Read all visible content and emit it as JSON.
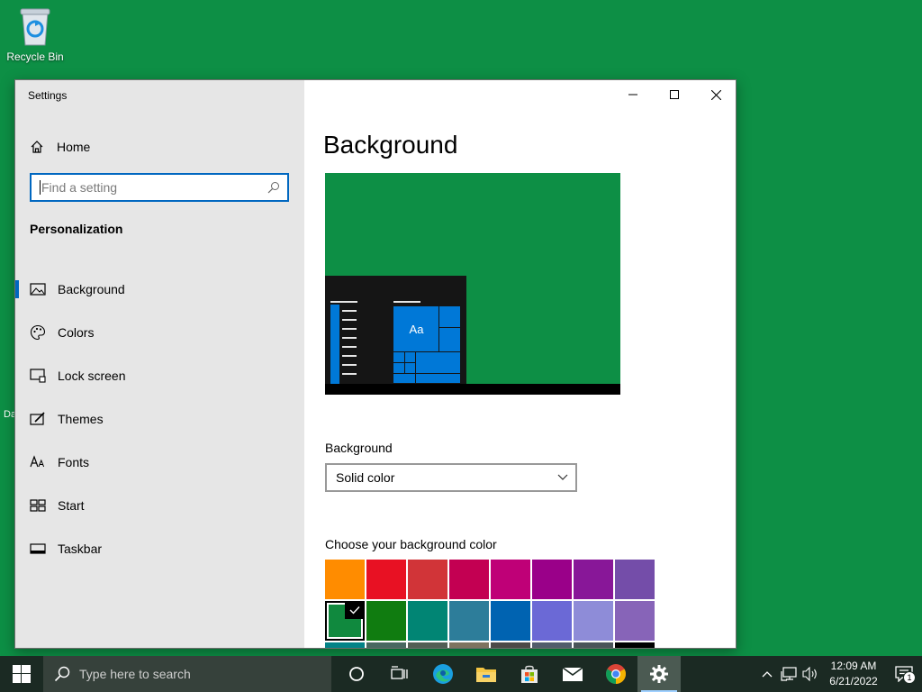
{
  "desktop": {
    "recycle_bin_label": "Recycle Bin",
    "partial_label": "Da"
  },
  "window": {
    "app_title": "Settings",
    "home_label": "Home",
    "search_placeholder": "Find a setting",
    "section_title": "Personalization",
    "nav_items": [
      {
        "label": "Background",
        "icon": "image-icon",
        "active": true
      },
      {
        "label": "Colors",
        "icon": "palette-icon",
        "active": false
      },
      {
        "label": "Lock screen",
        "icon": "lock-screen-icon",
        "active": false
      },
      {
        "label": "Themes",
        "icon": "themes-icon",
        "active": false
      },
      {
        "label": "Fonts",
        "icon": "fonts-icon",
        "active": false
      },
      {
        "label": "Start",
        "icon": "start-icon",
        "active": false
      },
      {
        "label": "Taskbar",
        "icon": "taskbar-icon",
        "active": false
      }
    ]
  },
  "content": {
    "page_title": "Background",
    "preview": {
      "tile_label": "Aa"
    },
    "background_label": "Background",
    "background_value": "Solid color",
    "color_label": "Choose your background color",
    "colors": [
      "#ff8c00",
      "#e81123",
      "#d13438",
      "#c30052",
      "#bf0077",
      "#9a0089",
      "#881798",
      "#744da9",
      "#10893e",
      "#107c10",
      "#018574",
      "#2d7d9a",
      "#0063b1",
      "#6b69d6",
      "#8e8cd8",
      "#8764b8",
      "#038387",
      "#486860",
      "#525e54",
      "#7e735f",
      "#4c4a48",
      "#515c6b",
      "#4a5459",
      "#000000"
    ],
    "selected_color_index": 8
  },
  "taskbar": {
    "search_placeholder": "Type here to search",
    "time": "12:09 AM",
    "date": "6/21/2022",
    "notification_count": "1"
  }
}
